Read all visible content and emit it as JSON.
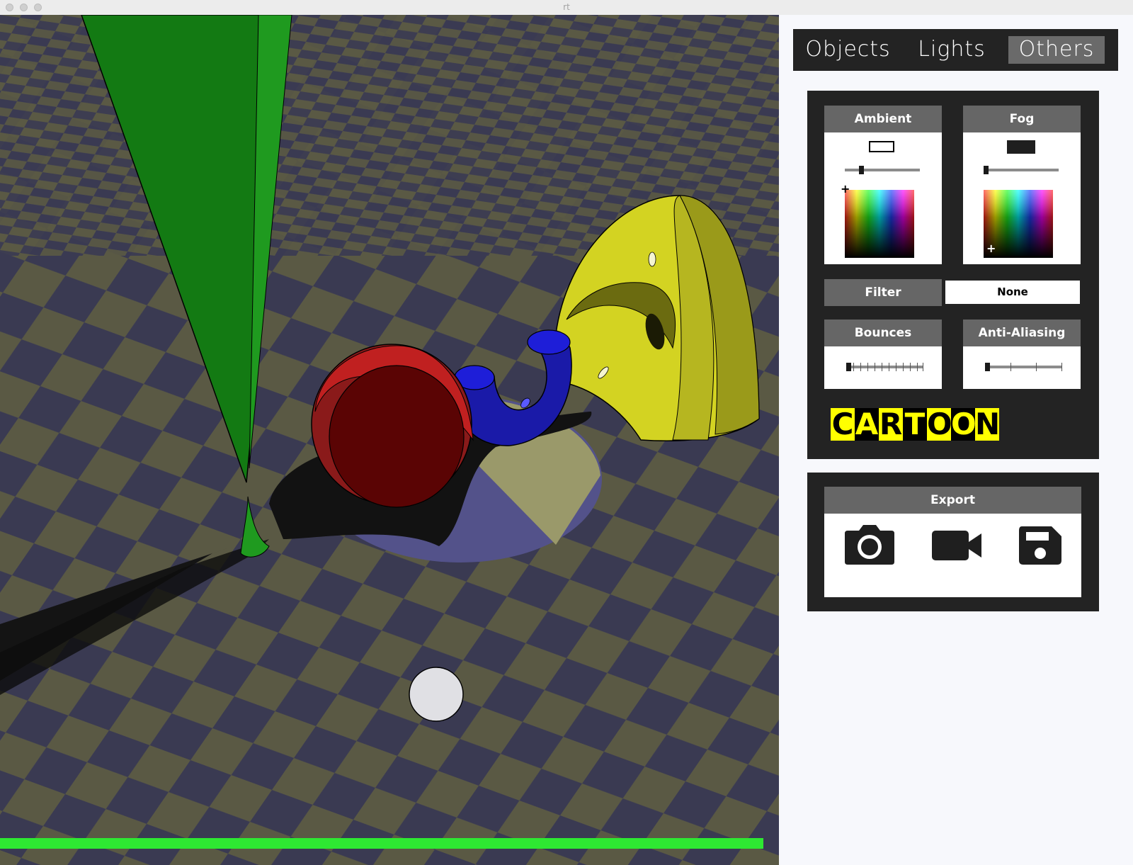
{
  "window": {
    "title": "rt"
  },
  "tabs": [
    {
      "label": "Objects",
      "active": false
    },
    {
      "label": "Lights",
      "active": false
    },
    {
      "label": "Others",
      "active": true
    }
  ],
  "others": {
    "ambient": {
      "label": "Ambient",
      "color": "#ffffff",
      "slider_level": 0.2
    },
    "fog": {
      "label": "Fog",
      "color": "#1f1f1f",
      "slider_level": 0.0
    },
    "filter": {
      "label": "Filter",
      "value": "None"
    },
    "bounces": {
      "label": "Bounces",
      "slider_level": 0.0
    },
    "anti_aliasing": {
      "label": "Anti-Aliasing",
      "slider_level": 0.0
    },
    "effect_banner": {
      "letters": [
        "C",
        "A",
        "R",
        "T",
        "O",
        "O",
        "N"
      ]
    }
  },
  "export": {
    "label": "Export",
    "buttons": [
      {
        "icon": "camera-icon"
      },
      {
        "icon": "video-camera-icon"
      },
      {
        "icon": "save-icon"
      }
    ]
  },
  "render": {
    "progress": 1.0,
    "progress_color": "#2ee832"
  }
}
